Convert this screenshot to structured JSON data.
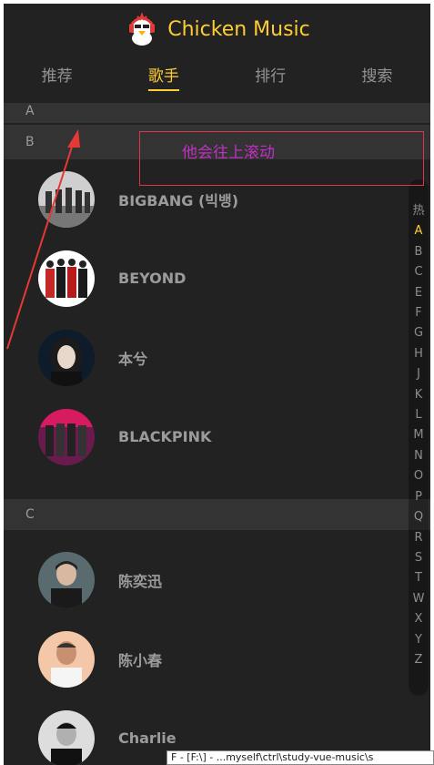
{
  "header": {
    "title": "Chicken Music"
  },
  "tabs": [
    {
      "label": "推荐",
      "active": false
    },
    {
      "label": "歌手",
      "active": true
    },
    {
      "label": "排行",
      "active": false
    },
    {
      "label": "搜索",
      "active": false
    }
  ],
  "groups": {
    "a": {
      "title": "A"
    },
    "b": {
      "title": "B"
    },
    "c": {
      "title": "C"
    }
  },
  "singers_b": [
    {
      "name": "BIGBANG (빅뱅)"
    },
    {
      "name": "BEYOND"
    },
    {
      "name": "本兮"
    },
    {
      "name": "BLACKPINK"
    }
  ],
  "singers_c": [
    {
      "name": "陈奕迅"
    },
    {
      "name": "陈小春"
    },
    {
      "name": "Charlie"
    }
  ],
  "shortcut": {
    "items": [
      "热",
      "A",
      "B",
      "C",
      "E",
      "F",
      "G",
      "H",
      "J",
      "K",
      "L",
      "M",
      "N",
      "O",
      "P",
      "Q",
      "R",
      "S",
      "T",
      "W",
      "X",
      "Y",
      "Z"
    ],
    "active": "A"
  },
  "annotation": {
    "text": "他会往上滚动"
  },
  "tooltip": {
    "text": "F - [F:\\] - ...myself\\ctrl\\study-vue-music\\s"
  },
  "colors": {
    "accent": "#ffcd32",
    "background": "#222222",
    "annotation": "#c030c0"
  }
}
